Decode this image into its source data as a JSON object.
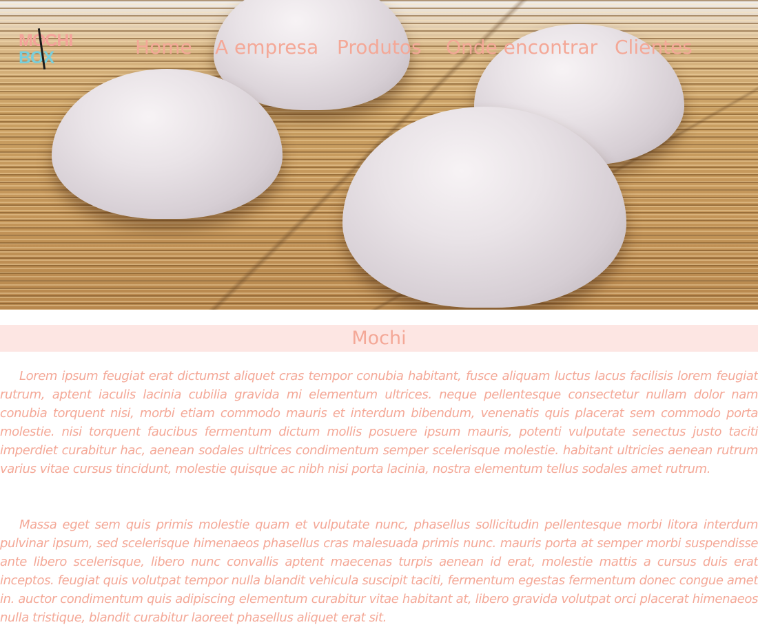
{
  "logo": {
    "line1": "MOCHI",
    "line2": "BOX"
  },
  "nav": {
    "items": [
      {
        "label": "Home"
      },
      {
        "label": "A empresa"
      },
      {
        "label": "Produtos"
      },
      {
        "label": "Onde encontrar"
      },
      {
        "label": "Clientes"
      }
    ]
  },
  "section": {
    "title": "Mochi",
    "paragraphs": [
      "Lorem ipsum feugiat erat dictumst aliquet cras tempor conubia habitant, fusce aliquam luctus lacus facilisis lorem feugiat rutrum, aptent iaculis lacinia cubilia gravida mi elementum ultrices. neque pellentesque consectetur nullam dolor nam conubia torquent nisi, morbi etiam commodo mauris et interdum bibendum, venenatis quis placerat sem commodo porta molestie. nisi torquent faucibus fermentum dictum mollis posuere ipsum mauris, potenti vulputate senectus justo taciti imperdiet curabitur hac, aenean sodales ultrices condimentum semper scelerisque molestie. habitant ultricies aenean rutrum varius vitae cursus tincidunt, molestie quisque ac nibh nisi porta lacinia, nostra elementum tellus sodales amet rutrum.",
      "Massa eget sem quis primis molestie quam et vulputate nunc, phasellus sollicitudin pellentesque morbi litora interdum pulvinar ipsum, sed scelerisque himenaeos phasellus cras malesuada primis nunc. mauris porta at semper morbi suspendisse ante libero scelerisque, libero nunc convallis aptent maecenas turpis aenean id erat, molestie mattis a cursus duis erat inceptos. feugiat quis volutpat tempor nulla blandit vehicula suscipit taciti, fermentum egestas fermentum donec congue amet in. auctor condimentum quis adipiscing elementum curabitur vitae habitant at, libero gravida volutpat orci placerat himenaeos nulla tristique, blandit curabitur laoreet phasellus aliquet erat sit."
    ]
  },
  "colors": {
    "accent": "#f4a897",
    "title_band": "#fde6e3",
    "logo_pink": "#f4a39a",
    "logo_teal": "#79cfdc"
  }
}
